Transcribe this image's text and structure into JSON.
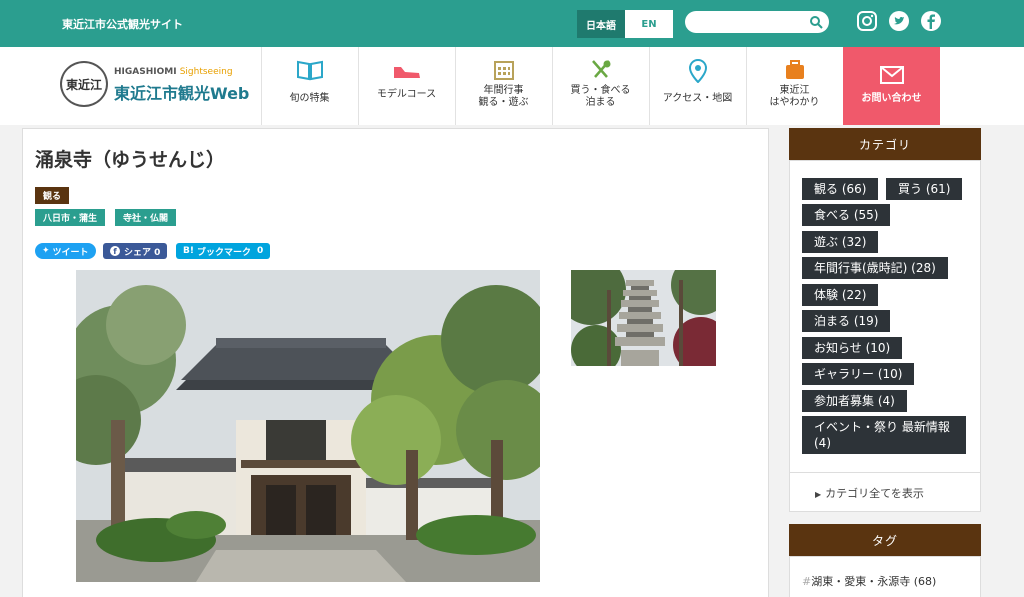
{
  "topbar": {
    "site_name": "東近江市公式観光サイト",
    "lang_ja": "日本語",
    "lang_en": "EN",
    "search_placeholder": "",
    "social": [
      "instagram-icon",
      "twitter-icon",
      "facebook-icon"
    ]
  },
  "logo": {
    "seal_text": "東近江",
    "en_line_1": "HIGASHIOMI",
    "en_line_2": "Sightseeing",
    "ja_line": "東近江市観光Web"
  },
  "nav": {
    "items": [
      {
        "label": "旬の特集",
        "icon": "book-icon"
      },
      {
        "label": "モデルコース",
        "icon": "shoe-icon"
      },
      {
        "label": "年間行事\n観る・遊ぶ",
        "icon": "calendar-icon"
      },
      {
        "label": "買う・食べる\n泊まる",
        "icon": "cutlery-icon"
      },
      {
        "label": "アクセス・地図",
        "icon": "map-pin-icon"
      },
      {
        "label": "東近江\nはやわかり",
        "icon": "suitcase-icon"
      }
    ],
    "contact_label": "お問い合わせ"
  },
  "article": {
    "title": "涌泉寺（ゆうせんじ）",
    "category_badge": "観る",
    "tags": [
      "八日市・蒲生",
      "寺社・仏閣"
    ],
    "share": {
      "tweet": "ツイート",
      "facebook": "シェア 0",
      "hatena": "ブックマーク",
      "hatena_count": "0"
    }
  },
  "sidebar": {
    "category_heading": "カテゴリ",
    "categories": [
      "観る (66)",
      "買う (61)",
      "食べる (55)",
      "遊ぶ (32)",
      "年間行事(歳時記) (28)",
      "体験 (22)",
      "泊まる (19)",
      "お知らせ (10)",
      "ギャラリー (10)",
      "参加者募集 (4)",
      "イベント・祭り 最新情報 (4)"
    ],
    "show_all": "カテゴリ全てを表示",
    "tag_heading": "タグ",
    "first_tag": "湖東・愛東・永源寺 (68)"
  },
  "colors": {
    "teal": "#2b9e8f",
    "brown": "#5a3410",
    "contact": "#f0596b",
    "dark": "#2d3338"
  }
}
